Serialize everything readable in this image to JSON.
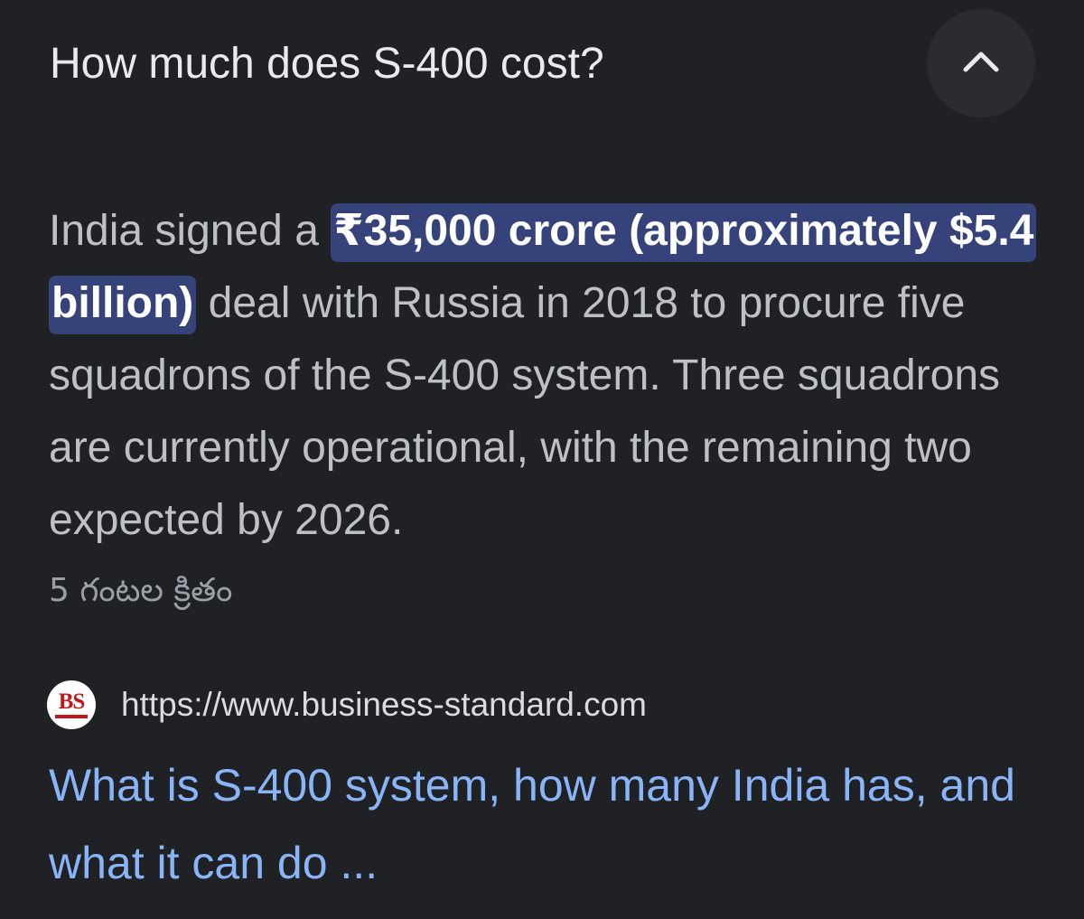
{
  "question": {
    "title": "How much does S-400 cost?",
    "toggle_icon": "chevron-up-icon"
  },
  "answer": {
    "prefix": "India signed a ",
    "highlight": "₹35,000 crore (approximately $5.4 billion)",
    "suffix": " deal with Russia in 2018 to procure five squadrons of the S-400 system. Three squadrons are currently operational, with the remaining two expected by 2026.",
    "timestamp": "5 గంటల క్రితం"
  },
  "source": {
    "favicon_text": "BS",
    "url": "https://www.business-standard.com",
    "title": "What is S-400 system, how many India has, and what it can do ..."
  },
  "colors": {
    "background": "#202124",
    "highlight_bg": "#36427a",
    "link": "#8ab4f8",
    "brand_red": "#c3161c"
  }
}
